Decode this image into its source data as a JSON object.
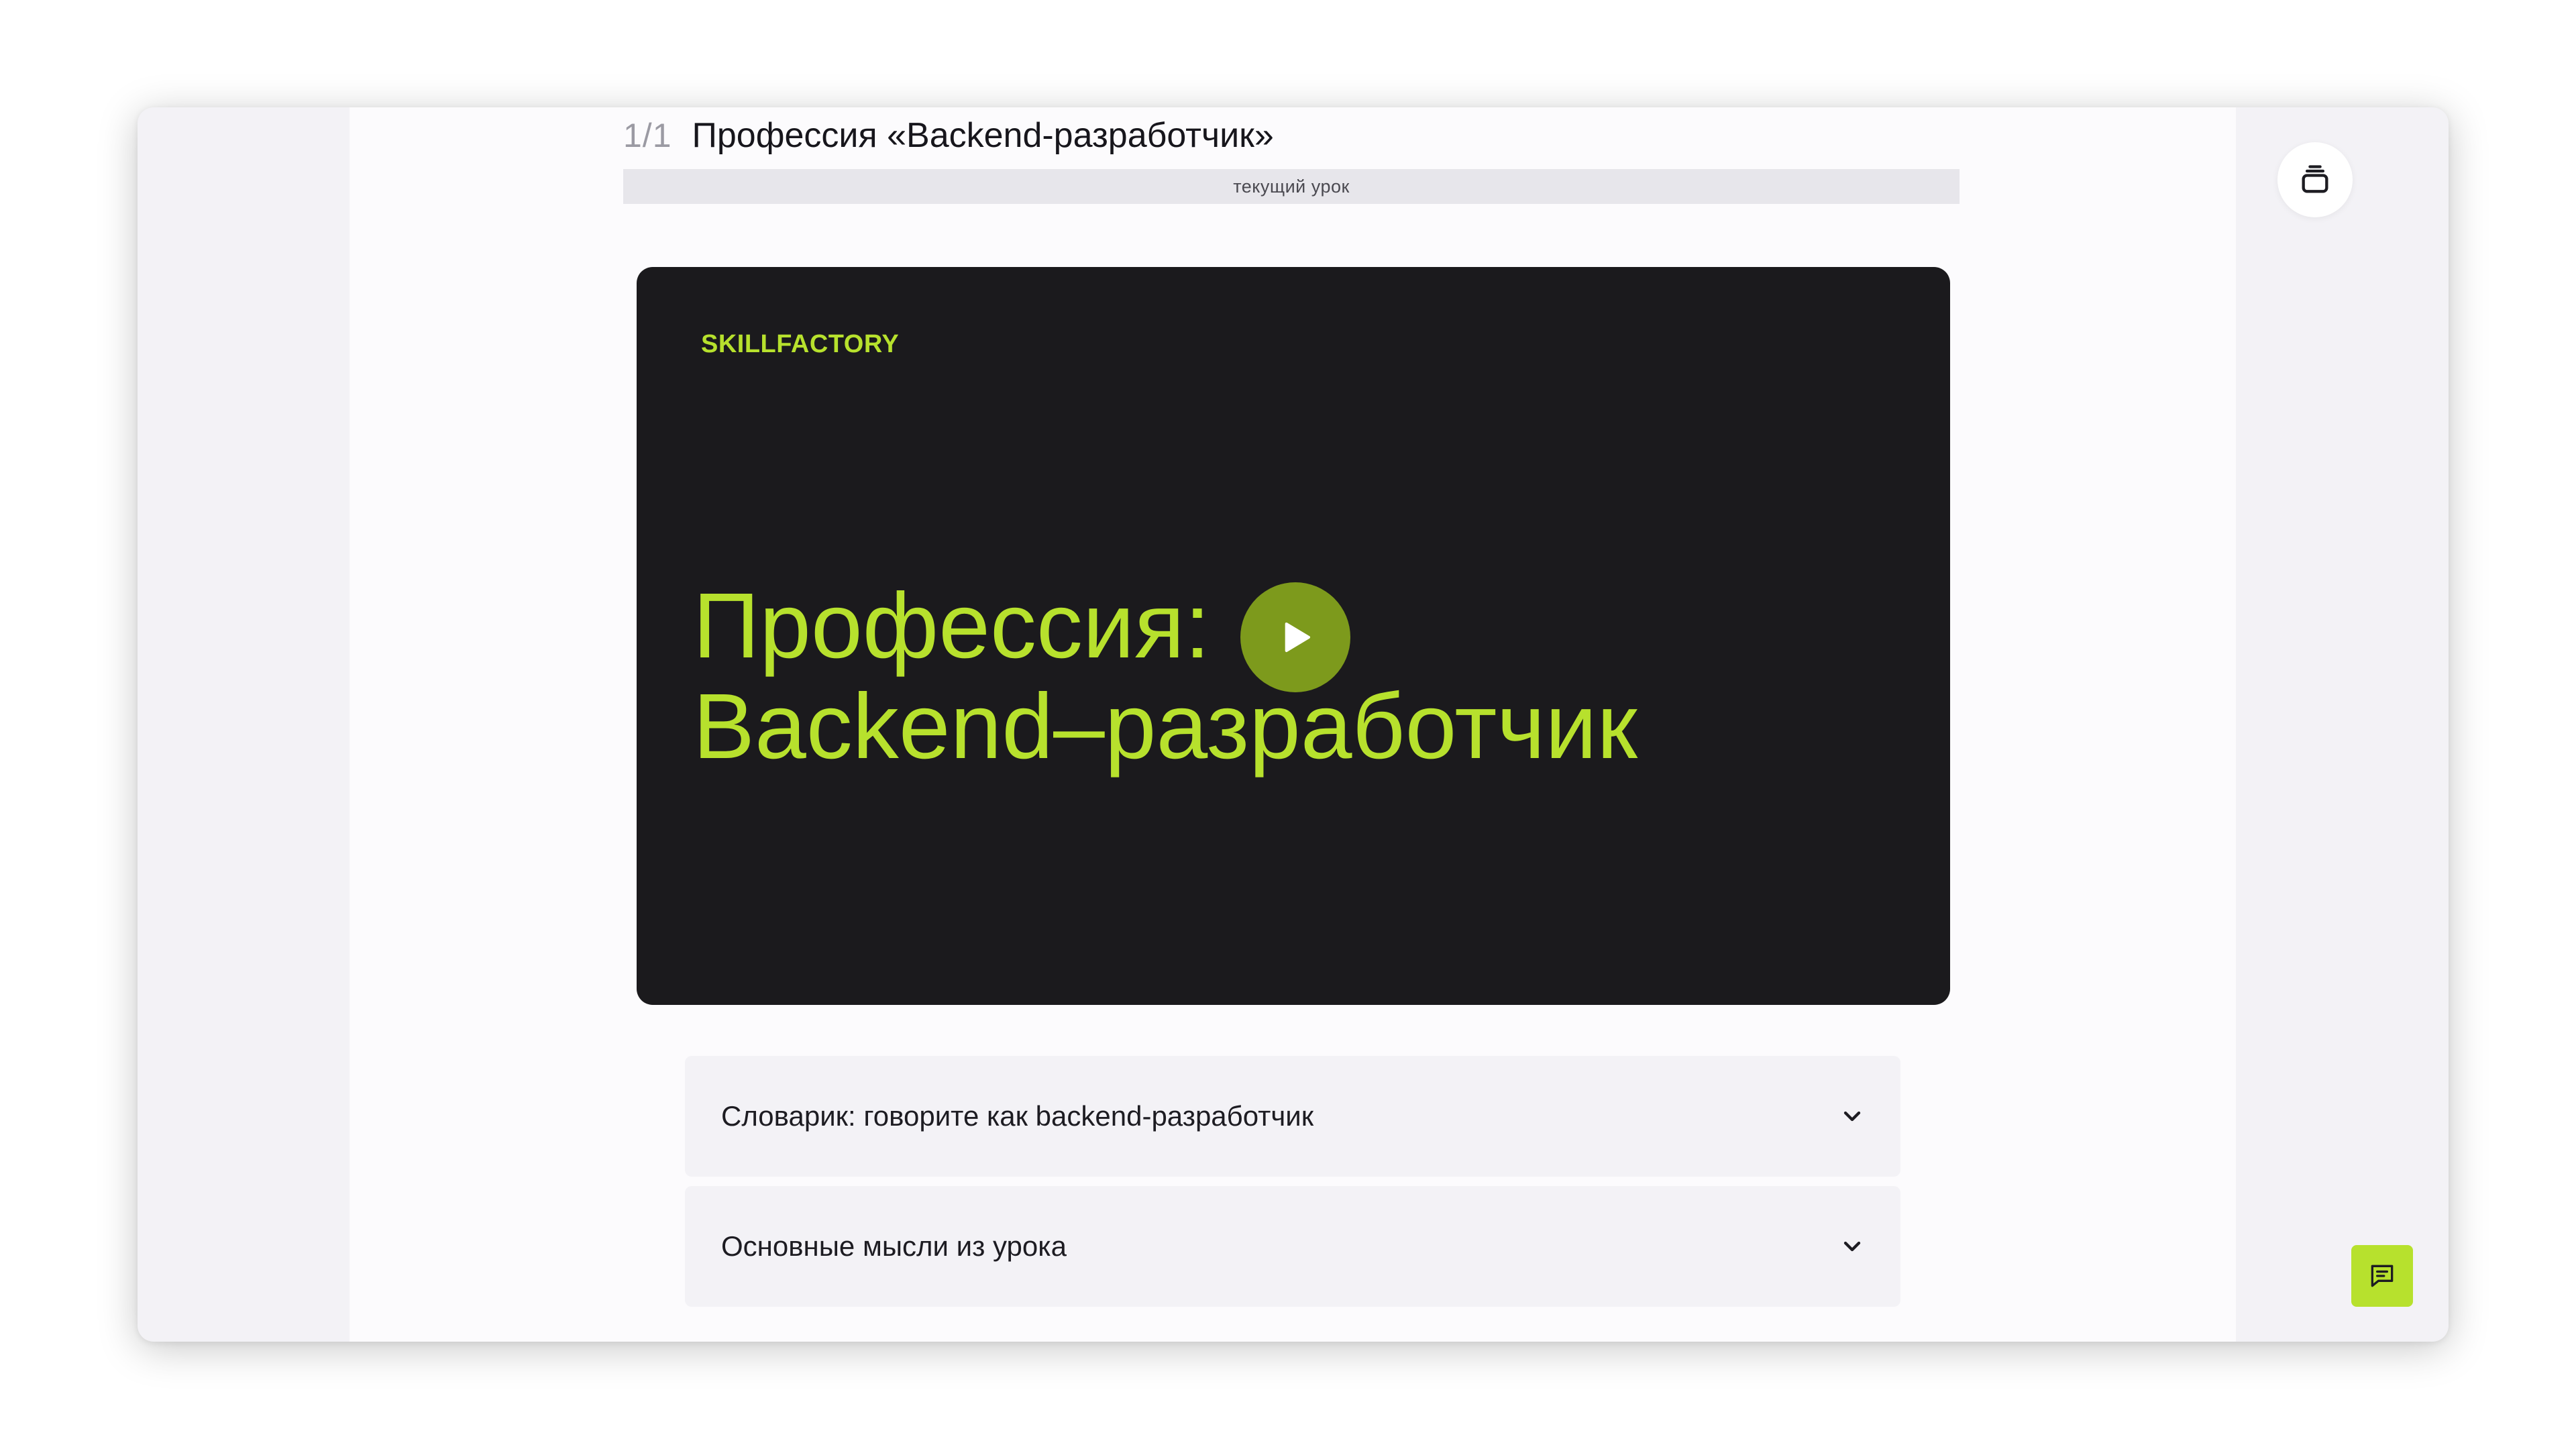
{
  "header": {
    "lesson_counter": "1/1",
    "course_title": "Профессия «Backend-разработчик»"
  },
  "progress": {
    "label": "текущий урок",
    "fraction": 1.0
  },
  "video": {
    "brand": "SKILLFACTORY",
    "title_line1": "Профессия:",
    "title_line2": "Backend–разработчик",
    "play_icon": "play-icon"
  },
  "accordions": [
    {
      "label": "Словарик: говорите как backend-разработчик",
      "icon": "chevron-down-icon"
    },
    {
      "label": "Основные мысли из урока",
      "icon": "chevron-down-icon"
    }
  ],
  "sidebar": {
    "lessons_icon": "stack-icon",
    "chat_icon": "chat-icon"
  },
  "colors": {
    "accent": "#b7e12d",
    "video_bg": "#1b1a1d",
    "play_bg": "#7d9a1c"
  }
}
